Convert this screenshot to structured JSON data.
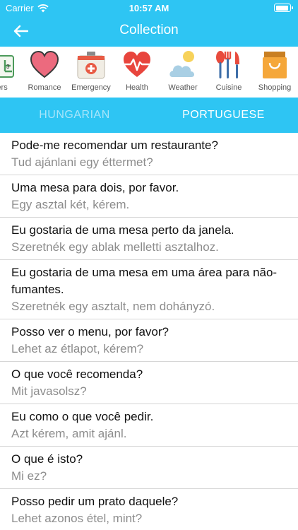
{
  "status": {
    "carrier": "Carrier",
    "time": "10:57 AM"
  },
  "nav": {
    "title": "Collection",
    "back_icon": "back-arrow-icon"
  },
  "categories": [
    {
      "label": "bers",
      "icon": "numbers-icon"
    },
    {
      "label": "Romance",
      "icon": "heart-icon"
    },
    {
      "label": "Emergency",
      "icon": "first-aid-kit-icon"
    },
    {
      "label": "Health",
      "icon": "heartbeat-icon"
    },
    {
      "label": "Weather",
      "icon": "weather-icon"
    },
    {
      "label": "Cuisine",
      "icon": "cutlery-icon"
    },
    {
      "label": "Shopping",
      "icon": "shopping-bag-icon"
    }
  ],
  "tabs": {
    "hungarian": "HUNGARIAN",
    "portuguese": "PORTUGUESE"
  },
  "phrases": [
    {
      "pt": "Pode-me recomendar um restaurante?",
      "hu": "Tud ajánlani egy éttermet?"
    },
    {
      "pt": "Uma mesa para dois, por favor.",
      "hu": "Egy asztal két, kérem."
    },
    {
      "pt": "Eu gostaria de uma mesa perto da janela.",
      "hu": "Szeretnék egy ablak melletti asztalhoz."
    },
    {
      "pt": "Eu gostaria de uma mesa em uma área para não-fumantes.",
      "hu": "Szeretnék egy asztalt, nem dohányzó."
    },
    {
      "pt": "Posso ver o menu, por favor?",
      "hu": "Lehet az étlapot, kérem?"
    },
    {
      "pt": "O que você recomenda?",
      "hu": "Mit javasolsz?"
    },
    {
      "pt": "Eu como o que você pedir.",
      "hu": "Azt kérem, amit ajánl."
    },
    {
      "pt": "O que é isto?",
      "hu": "Mi ez?"
    },
    {
      "pt": "Posso pedir um prato daquele?",
      "hu": "Lehet azonos étel, mint?"
    }
  ]
}
